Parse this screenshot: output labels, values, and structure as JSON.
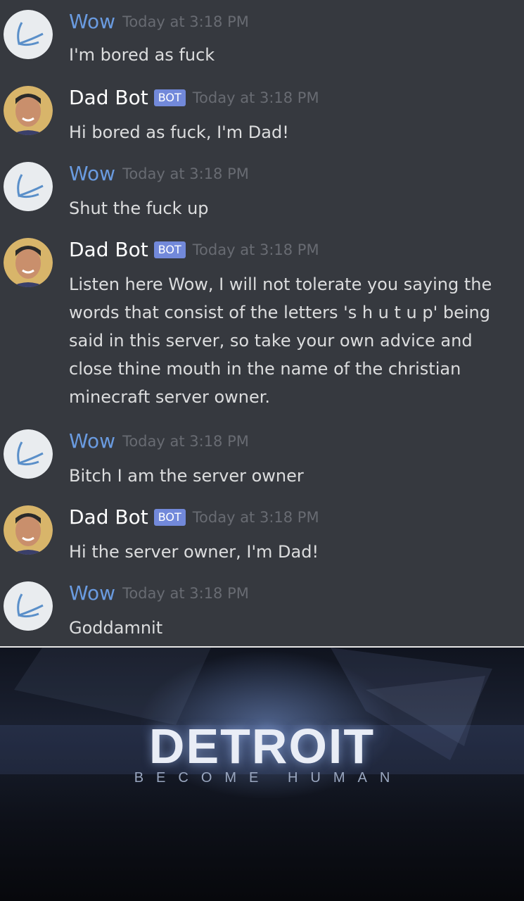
{
  "messages": [
    {
      "user": "Wow",
      "bot": false,
      "time": "Today at 3:18 PM",
      "text": "I'm bored as fuck"
    },
    {
      "user": "Dad Bot",
      "bot": true,
      "time": "Today at 3:18 PM",
      "text": "Hi bored as fuck, I'm Dad!"
    },
    {
      "user": "Wow",
      "bot": false,
      "time": "Today at 3:18 PM",
      "text": "Shut the fuck up"
    },
    {
      "user": "Dad Bot",
      "bot": true,
      "time": "Today at 3:18 PM",
      "text": "Listen here Wow, I will not tolerate you saying the words that consist of the letters 's h u t  u p' being said in this server, so take your own advice and close thine mouth in the name of the christian minecraft server owner."
    },
    {
      "user": "Wow",
      "bot": false,
      "time": "Today at 3:18 PM",
      "text": "Bitch I am the server owner"
    },
    {
      "user": "Dad Bot",
      "bot": true,
      "time": "Today at 3:18 PM",
      "text": "Hi the server owner, I'm Dad!"
    },
    {
      "user": "Wow",
      "bot": false,
      "time": "Today at 3:18 PM",
      "text": "Goddamnit"
    }
  ],
  "bot_tag": "BOT",
  "colors": {
    "background": "#36393f",
    "wow_name": "#6a9be0",
    "bot_tag": "#7289da",
    "timestamp": "#686b72"
  },
  "banner": {
    "title": "DETROIT",
    "tagline": "BECOME HUMAN"
  }
}
